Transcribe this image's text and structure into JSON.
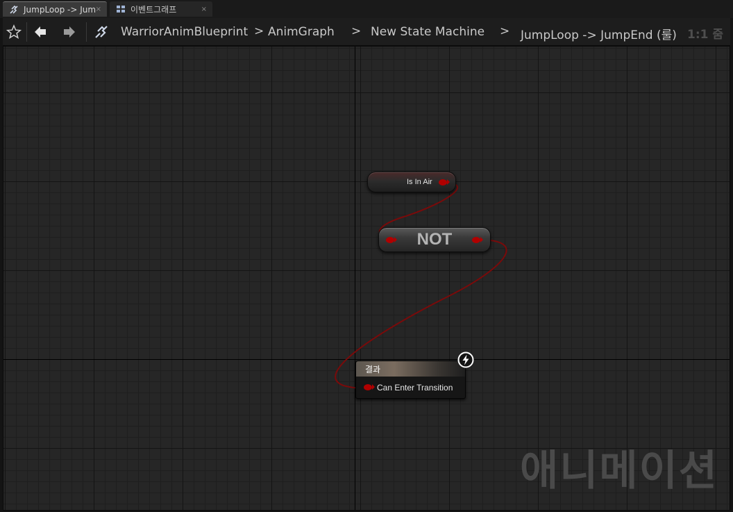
{
  "tabs": [
    {
      "label": "JumpLoop -> Jum",
      "close": "×",
      "icon": "transition-icon",
      "active": true
    },
    {
      "label": "이벤트그래프",
      "close": "×",
      "icon": "event-graph-icon",
      "active": false
    }
  ],
  "toolbar": {
    "breadcrumb": [
      "WarriorAnimBlueprint",
      "AnimGraph",
      "New State Machine",
      "JumpLoop -> JumpEnd (룰)"
    ],
    "separators": [
      ">",
      ">",
      ">"
    ],
    "zoom": "1:1 줌"
  },
  "graph": {
    "nodes": {
      "is_in_air": {
        "label": "Is In Air"
      },
      "not": {
        "label": "NOT"
      },
      "result": {
        "title": "결과",
        "pin_label": "Can Enter Transition"
      }
    },
    "watermark": "애니메이션"
  },
  "colors": {
    "wire": "#7a0a0a",
    "bool_pin": "#b00000",
    "background": "#262626"
  }
}
